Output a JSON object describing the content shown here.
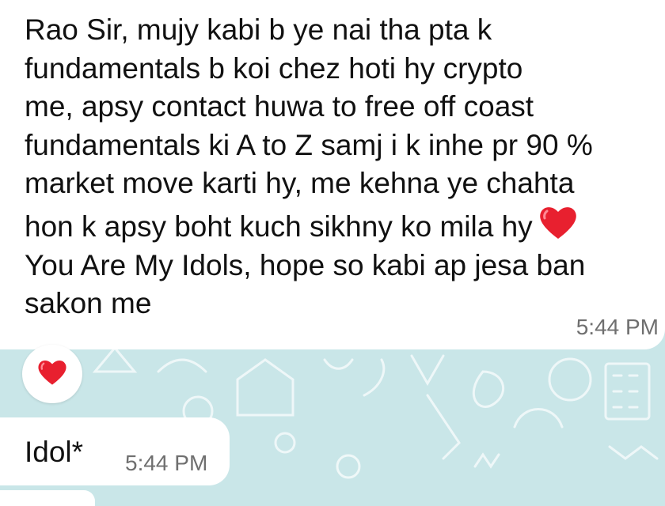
{
  "messages": [
    {
      "text": "Rao Sir, mujy kabi b ye nai tha pta k\nfundamentals b koi chez hoti hy crypto\nme, apsy contact huwa to free off coast\nfundamentals ki A to Z samj i k inhe pr 90 %\nmarket move karti hy, me kehna ye chahta\nhon k apsy boht kuch sikhny ko mila hy",
      "text_after_heart": "\nYou Are My Idols, hope so kabi ap jesa ban\nsakon me",
      "emoji": "heart-emoji",
      "time": "5:44 PM"
    },
    {
      "text": "Idol*",
      "time": "5:44 PM"
    }
  ],
  "reaction": {
    "emoji": "heart-emoji"
  },
  "colors": {
    "background": "#c9e6e8",
    "bubble": "#ffffff",
    "heart": "#e8202f",
    "time": "#6f6f6f"
  }
}
